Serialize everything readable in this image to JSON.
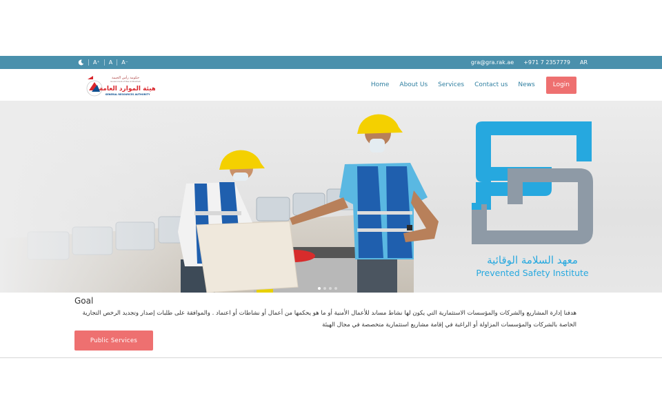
{
  "topbar": {
    "night_mode_icon": "moon-icon",
    "font_increase": "A⁺",
    "font_normal": "A",
    "font_decrease": "A⁻",
    "email": "gra@gra.rak.ae",
    "phone": "+971 7 2357779",
    "language": "AR"
  },
  "header": {
    "logo_text_ar": "هيئة الموارد العامة",
    "logo_text_en": "GENERAL RESOURCES AUTHORITY",
    "logo_gov_ar": "حكومة رأس الخيمة",
    "logo_gov_en": "Government of Ras Al Khaimah"
  },
  "nav": {
    "items": [
      {
        "label": "Home"
      },
      {
        "label": "About Us"
      },
      {
        "label": "Services"
      },
      {
        "label": "Contact us"
      },
      {
        "label": "News"
      }
    ],
    "login_label": "Login"
  },
  "hero": {
    "institute_ar": "معهد السلامة الوقائية",
    "institute_en": "Prevented Safety Institute",
    "slide_count": 4,
    "active_slide": 1
  },
  "goal": {
    "title": "Goal",
    "text": "هدفنا إدارة المشاريع والشركات والمؤسسات الاستثمارية التي يكون لها نشاط مساند للأعمال الأمنية أو ما هو يحكمها من أعمال أو نشاطات أو اعتماد . والموافقة على طلبات إصدار وتجديد الرخص التجارية الخاصة بالشركات والمؤسسات المزاولة أو الراغبة في إقامة مشاريع استثمارية متخصصة في مجال الهيئة",
    "button_label": "Public Services"
  },
  "colors": {
    "topbar": "#4a90ac",
    "nav_link": "#2f7fa0",
    "accent_button": "#ee7070",
    "logo_blue": "#29a9e0"
  }
}
